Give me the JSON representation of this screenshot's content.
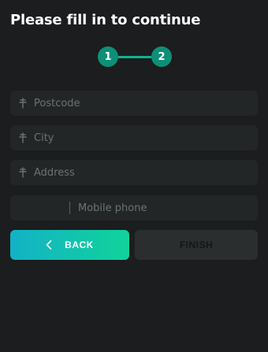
{
  "header": {
    "title": "Please fill in to continue"
  },
  "stepper": {
    "steps": [
      "1",
      "2"
    ],
    "active_color": "#0e8f78"
  },
  "form": {
    "postcode": {
      "placeholder": "Postcode",
      "value": ""
    },
    "city": {
      "placeholder": "City",
      "value": ""
    },
    "address": {
      "placeholder": "Address",
      "value": ""
    },
    "phone": {
      "placeholder": "Mobile phone",
      "value": ""
    },
    "field_icon": "map-pin-icon"
  },
  "actions": {
    "back_label": "BACK",
    "finish_label": "FINISH",
    "back_icon": "chevron-left-icon"
  },
  "colors": {
    "background": "#1b1d1e",
    "field": "#232627",
    "accent_start": "#12b2c6",
    "accent_end": "#11d39a",
    "disabled_button": "#2a2e2f"
  }
}
